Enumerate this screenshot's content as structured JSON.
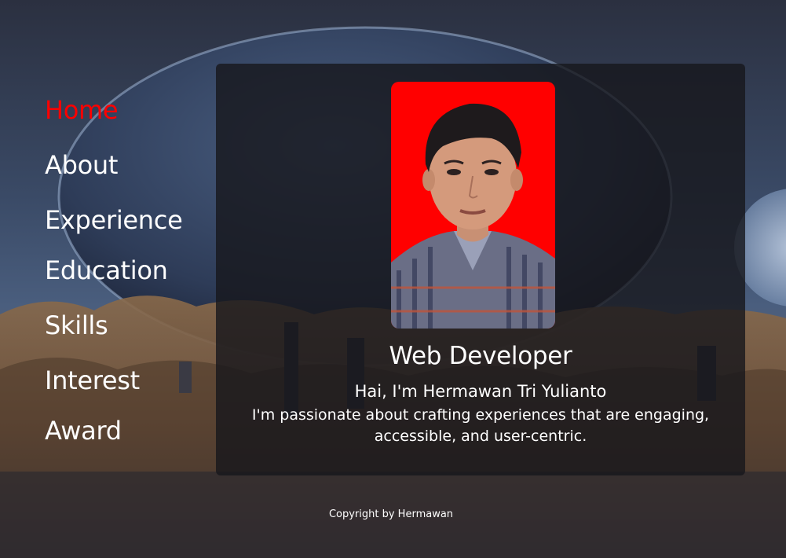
{
  "nav": {
    "items": [
      {
        "label": "Home",
        "active": true
      },
      {
        "label": "About",
        "active": false
      },
      {
        "label": "Experience",
        "active": false
      },
      {
        "label": "Education",
        "active": false
      },
      {
        "label": "Skills",
        "active": false
      },
      {
        "label": "Interest",
        "active": false
      },
      {
        "label": "Award",
        "active": false
      }
    ],
    "active_color": "#ff0000",
    "color": "#ffffff"
  },
  "hero": {
    "photo_background": "#ff0000",
    "role": "Web Developer",
    "greeting": "Hai, I'm Hermawan Tri Yulianto",
    "description": "I'm passionate about crafting experiences that are engaging, accessible, and user-centric."
  },
  "footer": {
    "copyright": "Copyright by Hermawan"
  }
}
